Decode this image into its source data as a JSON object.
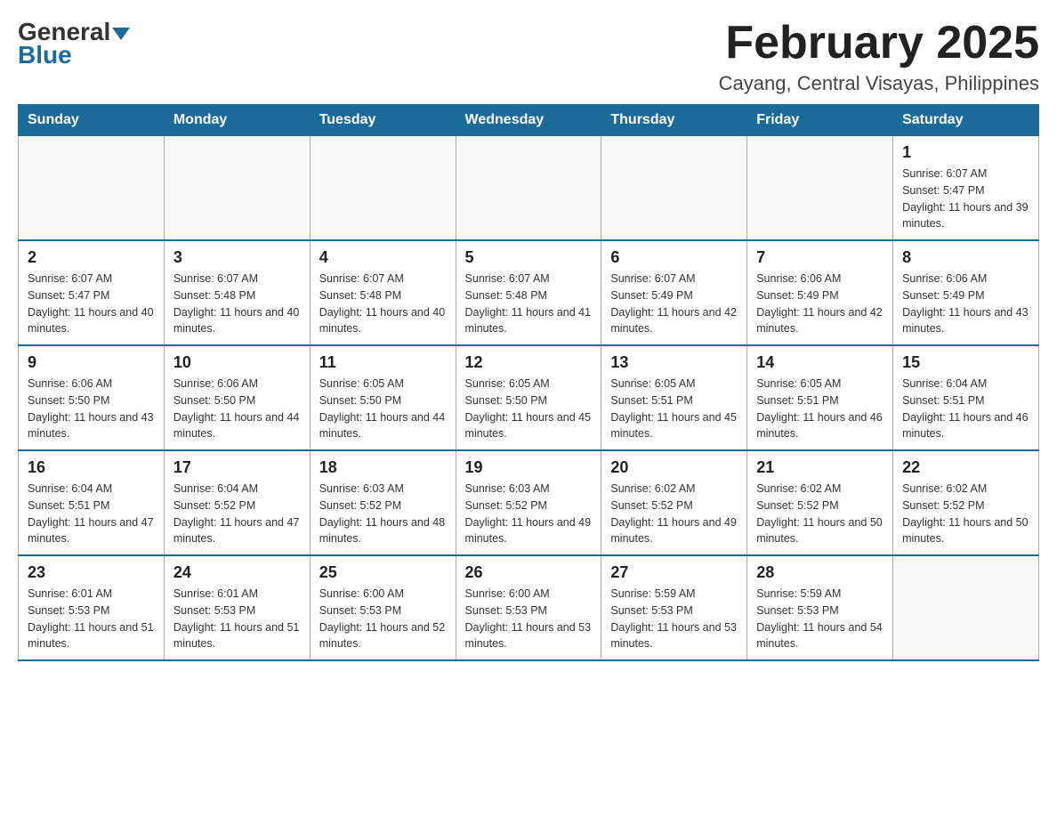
{
  "logo": {
    "general": "General",
    "blue": "Blue"
  },
  "title": "February 2025",
  "location": "Cayang, Central Visayas, Philippines",
  "days_of_week": [
    "Sunday",
    "Monday",
    "Tuesday",
    "Wednesday",
    "Thursday",
    "Friday",
    "Saturday"
  ],
  "weeks": [
    [
      {
        "day": "",
        "info": ""
      },
      {
        "day": "",
        "info": ""
      },
      {
        "day": "",
        "info": ""
      },
      {
        "day": "",
        "info": ""
      },
      {
        "day": "",
        "info": ""
      },
      {
        "day": "",
        "info": ""
      },
      {
        "day": "1",
        "info": "Sunrise: 6:07 AM\nSunset: 5:47 PM\nDaylight: 11 hours and 39 minutes."
      }
    ],
    [
      {
        "day": "2",
        "info": "Sunrise: 6:07 AM\nSunset: 5:47 PM\nDaylight: 11 hours and 40 minutes."
      },
      {
        "day": "3",
        "info": "Sunrise: 6:07 AM\nSunset: 5:48 PM\nDaylight: 11 hours and 40 minutes."
      },
      {
        "day": "4",
        "info": "Sunrise: 6:07 AM\nSunset: 5:48 PM\nDaylight: 11 hours and 40 minutes."
      },
      {
        "day": "5",
        "info": "Sunrise: 6:07 AM\nSunset: 5:48 PM\nDaylight: 11 hours and 41 minutes."
      },
      {
        "day": "6",
        "info": "Sunrise: 6:07 AM\nSunset: 5:49 PM\nDaylight: 11 hours and 42 minutes."
      },
      {
        "day": "7",
        "info": "Sunrise: 6:06 AM\nSunset: 5:49 PM\nDaylight: 11 hours and 42 minutes."
      },
      {
        "day": "8",
        "info": "Sunrise: 6:06 AM\nSunset: 5:49 PM\nDaylight: 11 hours and 43 minutes."
      }
    ],
    [
      {
        "day": "9",
        "info": "Sunrise: 6:06 AM\nSunset: 5:50 PM\nDaylight: 11 hours and 43 minutes."
      },
      {
        "day": "10",
        "info": "Sunrise: 6:06 AM\nSunset: 5:50 PM\nDaylight: 11 hours and 44 minutes."
      },
      {
        "day": "11",
        "info": "Sunrise: 6:05 AM\nSunset: 5:50 PM\nDaylight: 11 hours and 44 minutes."
      },
      {
        "day": "12",
        "info": "Sunrise: 6:05 AM\nSunset: 5:50 PM\nDaylight: 11 hours and 45 minutes."
      },
      {
        "day": "13",
        "info": "Sunrise: 6:05 AM\nSunset: 5:51 PM\nDaylight: 11 hours and 45 minutes."
      },
      {
        "day": "14",
        "info": "Sunrise: 6:05 AM\nSunset: 5:51 PM\nDaylight: 11 hours and 46 minutes."
      },
      {
        "day": "15",
        "info": "Sunrise: 6:04 AM\nSunset: 5:51 PM\nDaylight: 11 hours and 46 minutes."
      }
    ],
    [
      {
        "day": "16",
        "info": "Sunrise: 6:04 AM\nSunset: 5:51 PM\nDaylight: 11 hours and 47 minutes."
      },
      {
        "day": "17",
        "info": "Sunrise: 6:04 AM\nSunset: 5:52 PM\nDaylight: 11 hours and 47 minutes."
      },
      {
        "day": "18",
        "info": "Sunrise: 6:03 AM\nSunset: 5:52 PM\nDaylight: 11 hours and 48 minutes."
      },
      {
        "day": "19",
        "info": "Sunrise: 6:03 AM\nSunset: 5:52 PM\nDaylight: 11 hours and 49 minutes."
      },
      {
        "day": "20",
        "info": "Sunrise: 6:02 AM\nSunset: 5:52 PM\nDaylight: 11 hours and 49 minutes."
      },
      {
        "day": "21",
        "info": "Sunrise: 6:02 AM\nSunset: 5:52 PM\nDaylight: 11 hours and 50 minutes."
      },
      {
        "day": "22",
        "info": "Sunrise: 6:02 AM\nSunset: 5:52 PM\nDaylight: 11 hours and 50 minutes."
      }
    ],
    [
      {
        "day": "23",
        "info": "Sunrise: 6:01 AM\nSunset: 5:53 PM\nDaylight: 11 hours and 51 minutes."
      },
      {
        "day": "24",
        "info": "Sunrise: 6:01 AM\nSunset: 5:53 PM\nDaylight: 11 hours and 51 minutes."
      },
      {
        "day": "25",
        "info": "Sunrise: 6:00 AM\nSunset: 5:53 PM\nDaylight: 11 hours and 52 minutes."
      },
      {
        "day": "26",
        "info": "Sunrise: 6:00 AM\nSunset: 5:53 PM\nDaylight: 11 hours and 53 minutes."
      },
      {
        "day": "27",
        "info": "Sunrise: 5:59 AM\nSunset: 5:53 PM\nDaylight: 11 hours and 53 minutes."
      },
      {
        "day": "28",
        "info": "Sunrise: 5:59 AM\nSunset: 5:53 PM\nDaylight: 11 hours and 54 minutes."
      },
      {
        "day": "",
        "info": ""
      }
    ]
  ]
}
